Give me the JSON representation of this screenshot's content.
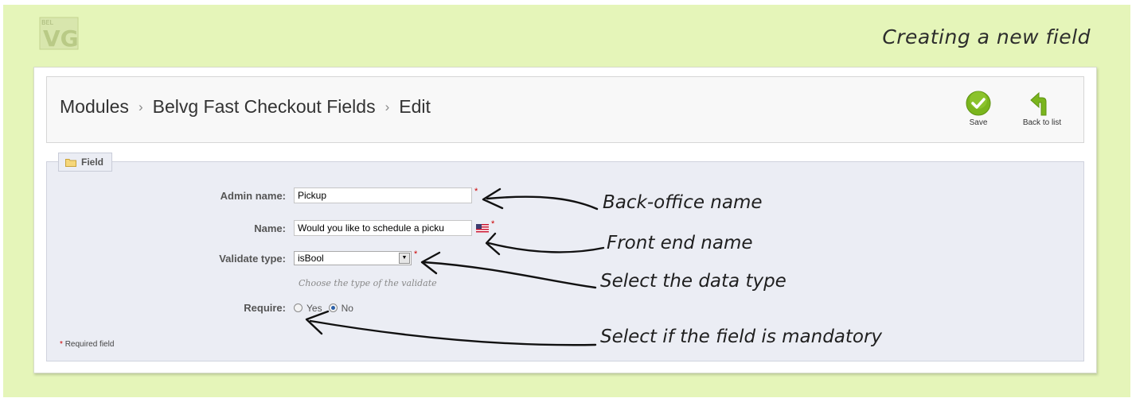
{
  "doc_title": "Creating a new field",
  "logo": {
    "text": "BEL",
    "mark": "VG"
  },
  "breadcrumb": [
    "Modules",
    "Belvg Fast Checkout Fields",
    "Edit"
  ],
  "breadcrumb_separator": "›",
  "toolbar": {
    "save_label": "Save",
    "back_label": "Back to list"
  },
  "fieldset": {
    "legend": "Field",
    "admin_name": {
      "label": "Admin name:",
      "value": "Pickup"
    },
    "name": {
      "label": "Name:",
      "value": "Would you like to schedule a picku"
    },
    "validate_type": {
      "label": "Validate type:",
      "selected": "isBool",
      "hint": "Choose the type of the validate"
    },
    "require": {
      "label": "Require:",
      "options": [
        "Yes",
        "No"
      ],
      "selected": "No"
    },
    "required_note": "Required field",
    "required_star": "*"
  },
  "annotations": [
    "Back-office name",
    "Front end name",
    "Select the data type",
    "Select if the field is mandatory"
  ],
  "colors": {
    "page_bg": "#e5f5b9",
    "save_green": "#7ab51d",
    "fieldset_bg": "#ebedf4"
  }
}
